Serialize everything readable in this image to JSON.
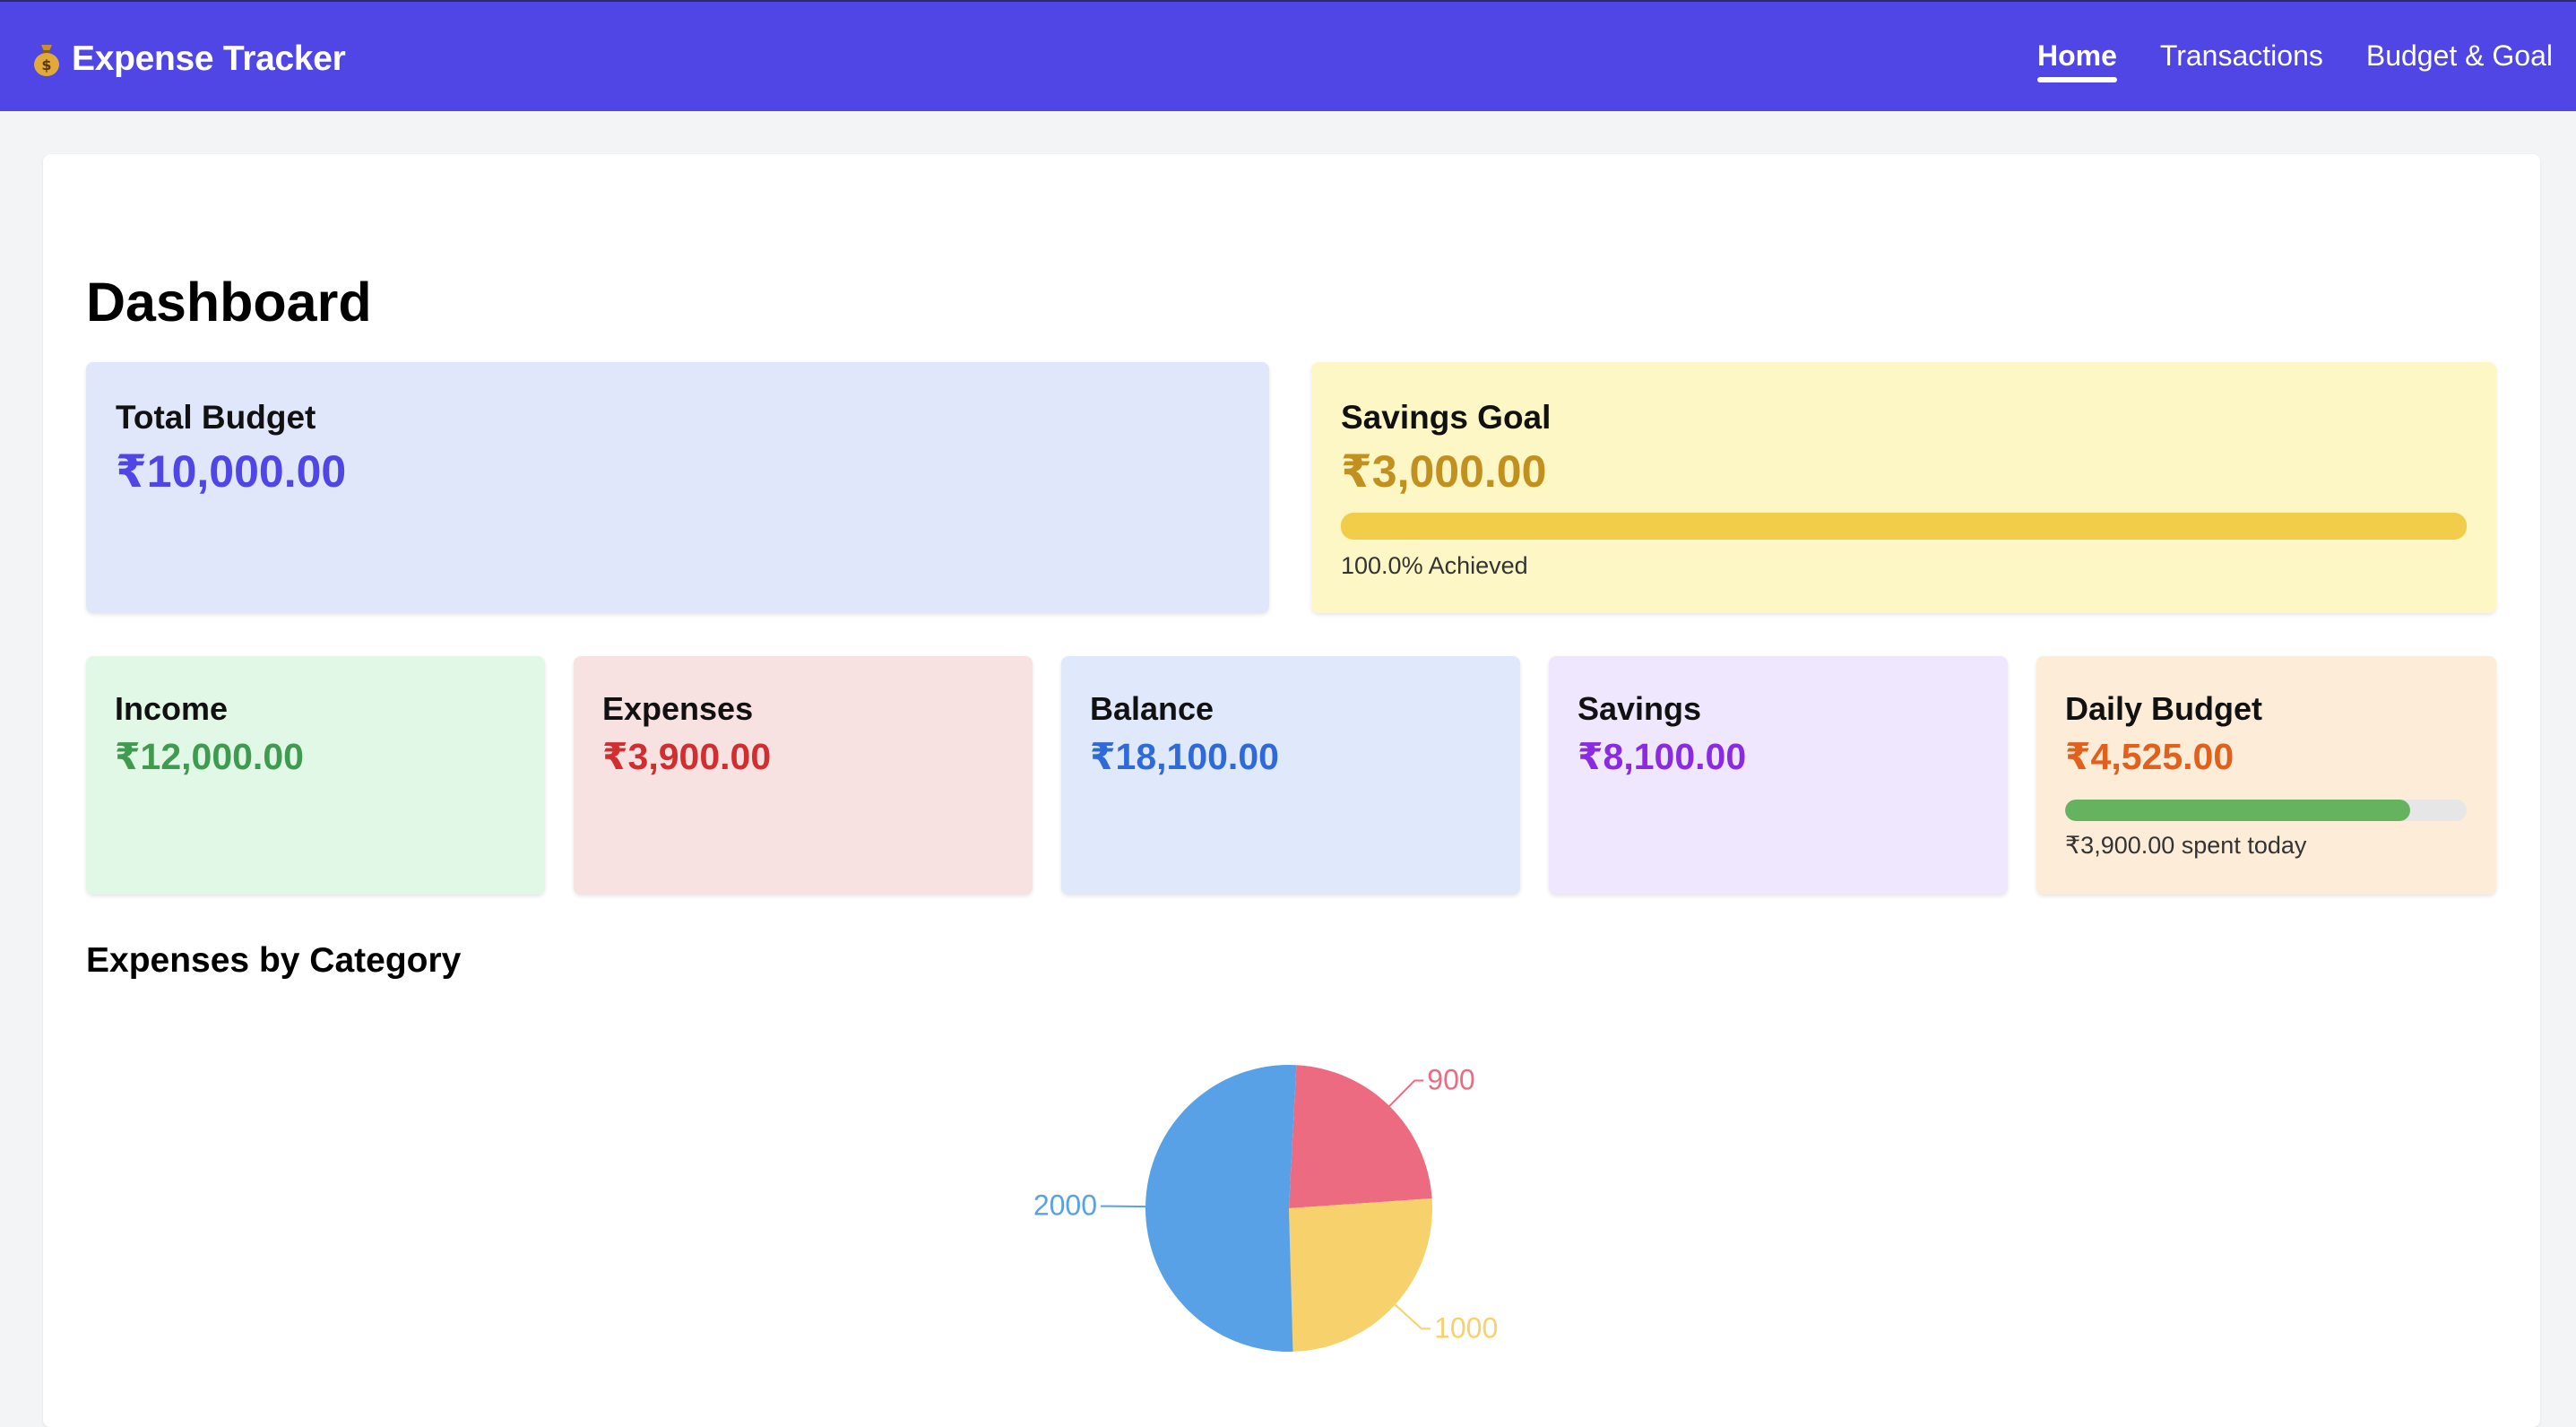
{
  "app": {
    "title": "Expense Tracker",
    "icon": "money-bag-icon"
  },
  "nav": {
    "items": [
      {
        "label": "Home",
        "active": true
      },
      {
        "label": "Transactions",
        "active": false
      },
      {
        "label": "Budget & Goal",
        "active": false
      }
    ]
  },
  "page": {
    "title": "Dashboard"
  },
  "total_budget": {
    "title": "Total Budget",
    "value": "₹10,000.00",
    "color": "#4f46e5",
    "bg": "#e0e7fb"
  },
  "savings_goal": {
    "title": "Savings Goal",
    "value": "₹3,000.00",
    "progress_percent": 100,
    "caption": "100.0% Achieved",
    "color": "#c2901f",
    "bar_color": "#f2cd4a",
    "bg": "#fdf7c6"
  },
  "stats": [
    {
      "title": "Income",
      "value": "₹12,000.00",
      "color": "#3f9b4f",
      "bg": "#e2f8e6"
    },
    {
      "title": "Expenses",
      "value": "₹3,900.00",
      "color": "#d12f2f",
      "bg": "#f8e1e1"
    },
    {
      "title": "Balance",
      "value": "₹18,100.00",
      "color": "#2e6bd9",
      "bg": "#dfe9fb"
    },
    {
      "title": "Savings",
      "value": "₹8,100.00",
      "color": "#8a2be2",
      "bg": "#efe7fd"
    }
  ],
  "daily_budget": {
    "title": "Daily Budget",
    "value": "₹4,525.00",
    "progress_percent": 86,
    "caption": "₹3,900.00 spent today",
    "color": "#e0601c",
    "bar_color": "#66b35f",
    "track_color": "#e6e6e6",
    "bg": "#fcecd8"
  },
  "chart_section": {
    "title": "Expenses by Category"
  },
  "chart_data": {
    "type": "pie",
    "values": [
      900,
      1000,
      2000
    ],
    "labels": [
      "900",
      "1000",
      "2000"
    ],
    "colors": [
      "#ed6b80",
      "#f7d16c",
      "#59a1e6"
    ]
  }
}
